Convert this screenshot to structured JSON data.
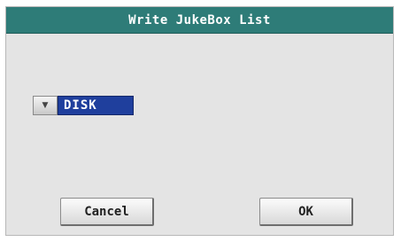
{
  "dialog": {
    "title": "Write JukeBox List"
  },
  "destination": {
    "selected": "DISK",
    "arrow_icon": "triangle-down"
  },
  "buttons": {
    "cancel_label": "Cancel",
    "ok_label": "OK"
  },
  "colors": {
    "titlebar": "#2e7c78",
    "selected_value_bg": "#1f3f9d",
    "dialog_bg": "#e4e4e4"
  }
}
